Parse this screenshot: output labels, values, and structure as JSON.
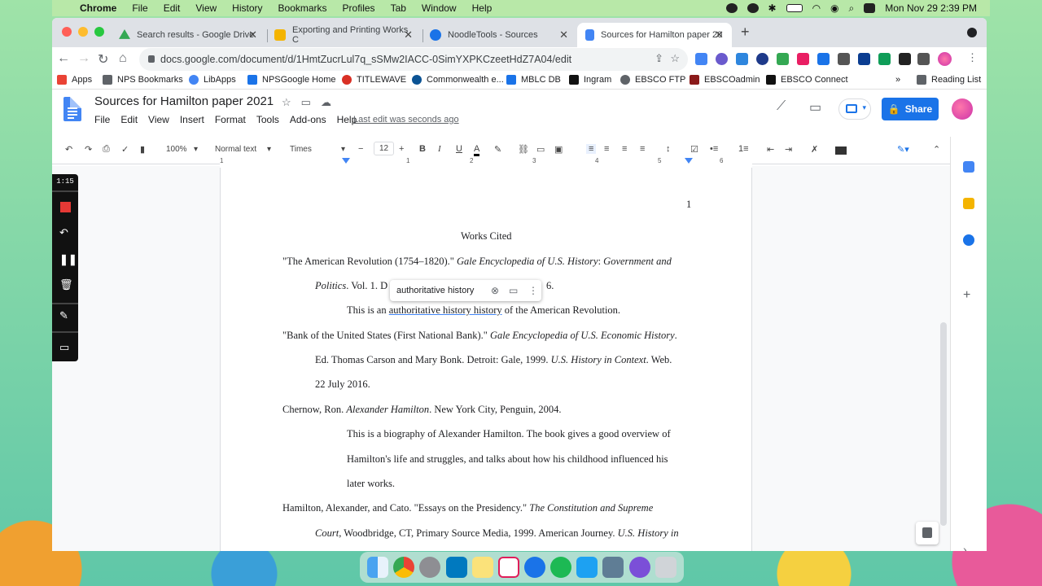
{
  "menubar": {
    "app": "Chrome",
    "items": [
      "File",
      "Edit",
      "View",
      "History",
      "Bookmarks",
      "Profiles",
      "Tab",
      "Window",
      "Help"
    ],
    "datetime": "Mon Nov 29  2:39 PM"
  },
  "tabs": [
    {
      "title": "Search results - Google Drive",
      "color": "#34a853"
    },
    {
      "title": "Exporting and Printing Works C",
      "color": "#f4b400"
    },
    {
      "title": "NoodleTools - Sources",
      "color": "#1a73e8"
    },
    {
      "title": "Sources for Hamilton paper 20",
      "color": "#4285f4"
    }
  ],
  "address": {
    "url": "docs.google.com/document/d/1HmtZucrLul7q_sSMw2IACC-0SimYXPKCzeetHdZ7A04/edit"
  },
  "bookmarks": [
    {
      "label": "Apps",
      "color": "#ea4335"
    },
    {
      "label": "NPS Bookmarks",
      "color": "#5f6368"
    },
    {
      "label": "LibApps",
      "color": "#4285f4"
    },
    {
      "label": "NPSGoogle Home",
      "color": "#1a73e8"
    },
    {
      "label": "TITLEWAVE",
      "color": "#d93025"
    },
    {
      "label": "Commonwealth e...",
      "color": "#0b5394"
    },
    {
      "label": "MBLC DB",
      "color": "#1a73e8"
    },
    {
      "label": "Ingram",
      "color": "#111"
    },
    {
      "label": "EBSCO FTP",
      "color": "#5f6368"
    },
    {
      "label": "EBSCOadmin",
      "color": "#8b1a1a"
    },
    {
      "label": "EBSCO Connect",
      "color": "#111"
    },
    {
      "label": "Reading List",
      "color": "#5f6368"
    }
  ],
  "doc": {
    "title": "Sources for Hamilton paper 2021",
    "menu": [
      "File",
      "Edit",
      "View",
      "Insert",
      "Format",
      "Tools",
      "Add-ons",
      "Help"
    ],
    "last_edit": "Last edit was seconds ago",
    "share_label": "Share"
  },
  "format_toolbar": {
    "zoom": "100%",
    "style": "Normal text",
    "font": "Times",
    "size": "12"
  },
  "ruler": {
    "numbers": [
      "1",
      "1",
      "2",
      "3",
      "4",
      "5",
      "6",
      "7"
    ]
  },
  "page": {
    "page_number": "1",
    "heading": "Works Cited",
    "e1_l1a": "\"The American Revolution (1754–1820).\" ",
    "e1_l1b": "Gale Encyclopedia of U.S. History",
    "e1_l1c": ": ",
    "e1_l1d": "Government and",
    "e1_l2a": "Politics",
    "e1_l2b": ". Vol. 1. D",
    "e1_l2c": "6.",
    "e1_ann_a": "This is an ",
    "e1_ann_b": "authoritative history history",
    "e1_ann_c": " of the American Revolution.",
    "e2_l1a": "\"Bank of the United States (First National Bank).\" ",
    "e2_l1b": "Gale Encyclopedia of U.S. Economic History",
    "e2_l1c": ".",
    "e2_l2a": "Ed. Thomas Carson and Mary Bonk. Detroit: Gale, 1999. ",
    "e2_l2b": "U.S. History in Context",
    "e2_l2c": ". Web.",
    "e2_l3": "22 July 2016.",
    "e3_l1a": "Chernow, Ron. ",
    "e3_l1b": "Alexander Hamilton",
    "e3_l1c": ". New York City, Penguin, 2004.",
    "e3_ann1": "This is a biography of Alexander Hamilton. The book gives a good overview of",
    "e3_ann2": "Hamilton's life and struggles, and talks about how his childhood influenced his",
    "e3_ann3": "later works.",
    "e4_l1a": "Hamilton, Alexander, and Cato. \"Essays on the Presidency.\" ",
    "e4_l1b": "The Constitution and Supreme",
    "e4_l2a": "Court",
    "e4_l2b": ", Woodbridge, CT, Primary Source Media, 1999. American Journey. ",
    "e4_l2c": "U.S. History in"
  },
  "tooltip": {
    "text": "authoritative history"
  },
  "recorder": {
    "time": "1:15"
  }
}
